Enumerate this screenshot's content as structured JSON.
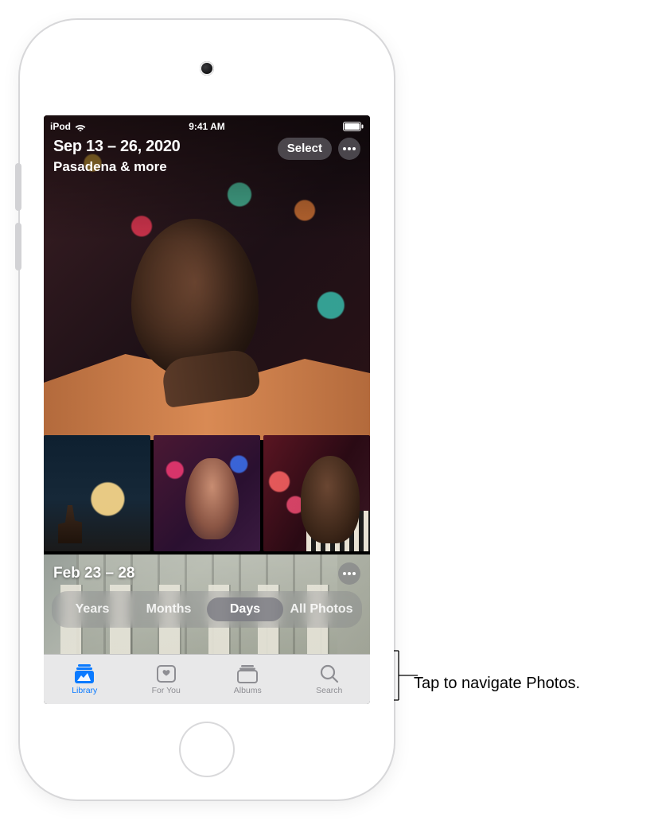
{
  "status_bar": {
    "carrier": "iPod",
    "time": "9:41 AM"
  },
  "header": {
    "date_range": "Sep 13 – 26, 2020",
    "location_summary": "Pasadena & more",
    "select_label": "Select"
  },
  "section2": {
    "date_range": "Feb 23 – 28"
  },
  "view_filter": {
    "items": [
      {
        "label": "Years",
        "active": false
      },
      {
        "label": "Months",
        "active": false
      },
      {
        "label": "Days",
        "active": true
      },
      {
        "label": "All Photos",
        "active": false
      }
    ]
  },
  "tabbar": {
    "items": [
      {
        "label": "Library",
        "active": true
      },
      {
        "label": "For You",
        "active": false
      },
      {
        "label": "Albums",
        "active": false
      },
      {
        "label": "Search",
        "active": false
      }
    ]
  },
  "annotation": {
    "tabbar_callout": "Tap to navigate Photos."
  }
}
